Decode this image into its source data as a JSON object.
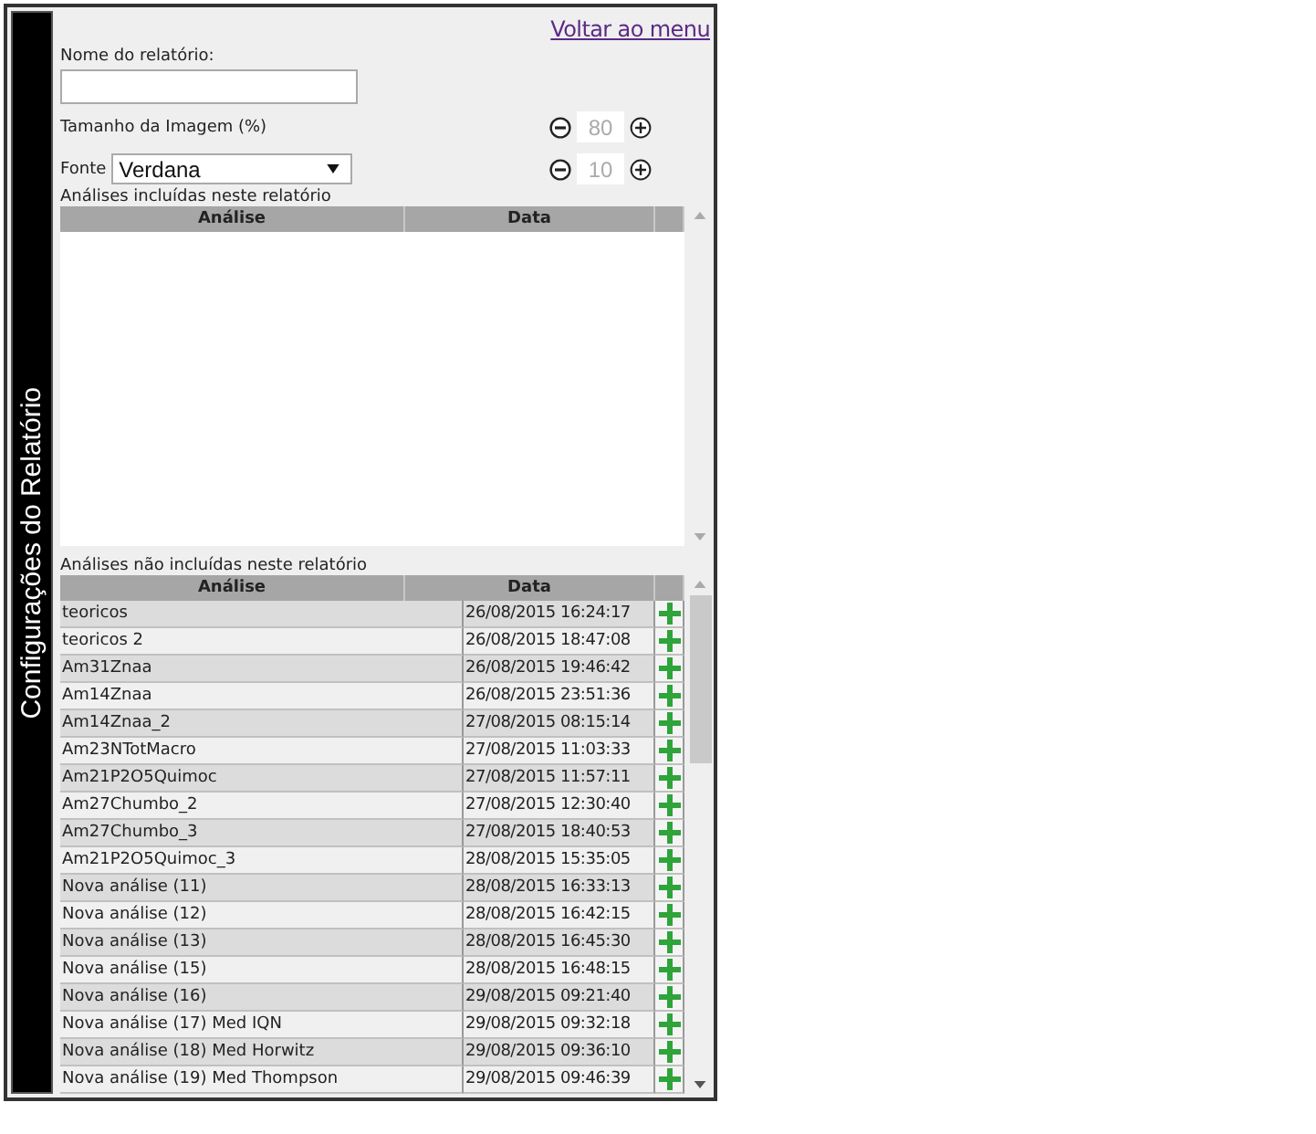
{
  "sidebar": {
    "title": "Configurações do Relatório"
  },
  "back_link": "Voltar ao menu",
  "report_name": {
    "label": "Nome do relatório:"
  },
  "image_size": {
    "label": "Tamanho da Imagem (%)",
    "value": "80"
  },
  "font": {
    "label": "Fonte",
    "value": "Verdana",
    "size": "10"
  },
  "included": {
    "title": "Análises incluídas neste relatório",
    "columns": [
      "Análise",
      "Data"
    ]
  },
  "excluded": {
    "title": "Análises não incluídas neste relatório",
    "columns": [
      "Análise",
      "Data"
    ],
    "rows": [
      {
        "name": "teoricos",
        "date": "26/08/2015 16:24:17"
      },
      {
        "name": "teoricos 2",
        "date": "26/08/2015 18:47:08"
      },
      {
        "name": "Am31Znaa",
        "date": "26/08/2015 19:46:42"
      },
      {
        "name": "Am14Znaa",
        "date": "26/08/2015 23:51:36"
      },
      {
        "name": "Am14Znaa_2",
        "date": "27/08/2015 08:15:14"
      },
      {
        "name": "Am23NTotMacro",
        "date": "27/08/2015 11:03:33"
      },
      {
        "name": "Am21P2O5Quimoc",
        "date": "27/08/2015 11:57:11"
      },
      {
        "name": "Am27Chumbo_2",
        "date": "27/08/2015 12:30:40"
      },
      {
        "name": "Am27Chumbo_3",
        "date": "27/08/2015 18:40:53"
      },
      {
        "name": "Am21P2O5Quimoc_3",
        "date": "28/08/2015 15:35:05"
      },
      {
        "name": "Nova análise (11)",
        "date": "28/08/2015 16:33:13"
      },
      {
        "name": "Nova análise (12)",
        "date": "28/08/2015 16:42:15"
      },
      {
        "name": "Nova análise (13)",
        "date": "28/08/2015 16:45:30"
      },
      {
        "name": "Nova análise (15)",
        "date": "28/08/2015 16:48:15"
      },
      {
        "name": "Nova análise (16)",
        "date": "29/08/2015 09:21:40"
      },
      {
        "name": "Nova análise (17) Med IQN",
        "date": "29/08/2015 09:32:18"
      },
      {
        "name": "Nova análise (18) Med Horwitz",
        "date": "29/08/2015 09:36:10"
      },
      {
        "name": "Nova análise (19) Med Thompson",
        "date": "29/08/2015 09:46:39"
      }
    ]
  }
}
